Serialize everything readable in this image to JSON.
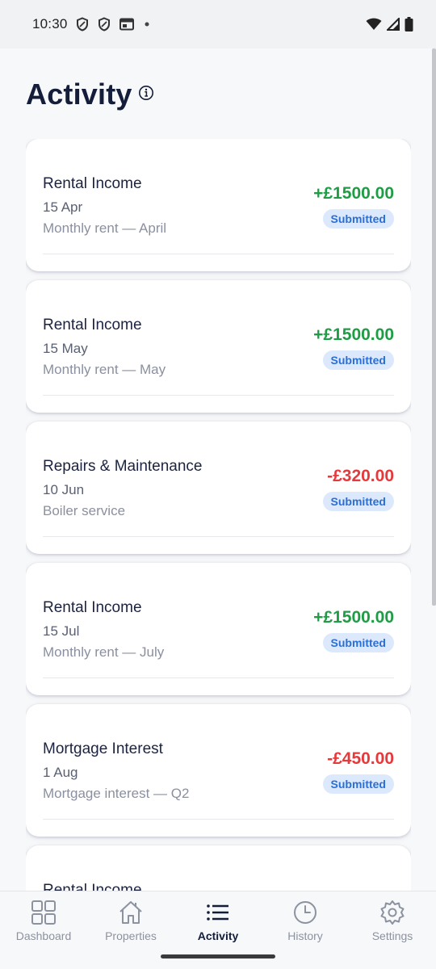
{
  "status_bar": {
    "time": "10:30"
  },
  "header": {
    "title": "Activity"
  },
  "transactions": [
    {
      "title": "Rental Income",
      "date": "15 Apr",
      "note": "Monthly rent — April",
      "amount": "+£1500.00",
      "direction": "income",
      "status": "Submitted"
    },
    {
      "title": "Rental Income",
      "date": "15 May",
      "note": "Monthly rent — May",
      "amount": "+£1500.00",
      "direction": "income",
      "status": "Submitted"
    },
    {
      "title": "Repairs & Maintenance",
      "date": "10 Jun",
      "note": "Boiler service",
      "amount": "-£320.00",
      "direction": "expense",
      "status": "Submitted"
    },
    {
      "title": "Rental Income",
      "date": "15 Jul",
      "note": "Monthly rent — July",
      "amount": "+£1500.00",
      "direction": "income",
      "status": "Submitted"
    },
    {
      "title": "Mortgage Interest",
      "date": "1 Aug",
      "note": "Mortgage interest — Q2",
      "amount": "-£450.00",
      "direction": "expense",
      "status": "Submitted"
    },
    {
      "title": "Rental Income",
      "date": "",
      "note": "",
      "amount": "",
      "direction": "income",
      "status": ""
    }
  ],
  "bottom_nav": [
    {
      "label": "Dashboard",
      "icon": "grid-icon",
      "active": false
    },
    {
      "label": "Properties",
      "icon": "home-icon",
      "active": false
    },
    {
      "label": "Activity",
      "icon": "list-icon",
      "active": true
    },
    {
      "label": "History",
      "icon": "clock-icon",
      "active": false
    },
    {
      "label": "Settings",
      "icon": "gear-icon",
      "active": false
    }
  ],
  "colors": {
    "income": "#1f9d45",
    "expense": "#e5393b",
    "badge_bg": "#dce8fb",
    "badge_text": "#2a6fd6",
    "title": "#141d3a"
  }
}
